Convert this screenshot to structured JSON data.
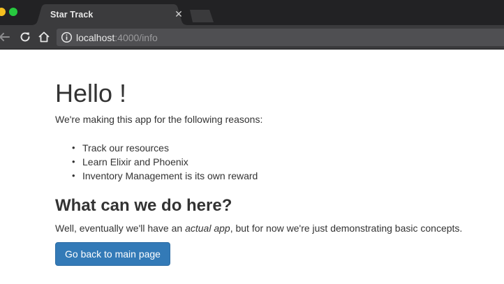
{
  "browser": {
    "tab_title": "Star Track",
    "tab_close_icon": "close-icon",
    "url_host": "localhost",
    "url_rest": ":4000/info",
    "icons": [
      "back-arrow-icon",
      "reload-icon",
      "home-icon",
      "info-icon"
    ]
  },
  "page": {
    "heading": "Hello !",
    "intro": "We're making this app for the following reasons:",
    "reasons": [
      "Track our resources",
      "Learn Elixir and Phoenix",
      "Inventory Management is its own reward"
    ],
    "subheading": "What can we do here?",
    "paragraph": {
      "before": "Well, eventually we'll have an ",
      "emphasis": "actual app",
      "after": ", but for now we're just demonstrating basic concepts."
    },
    "button_label": "Go back to main page"
  },
  "colors": {
    "accent": "#337ab7",
    "text": "#333333",
    "chrome_dark": "#222224",
    "toolbar": "#3b3b3d"
  }
}
